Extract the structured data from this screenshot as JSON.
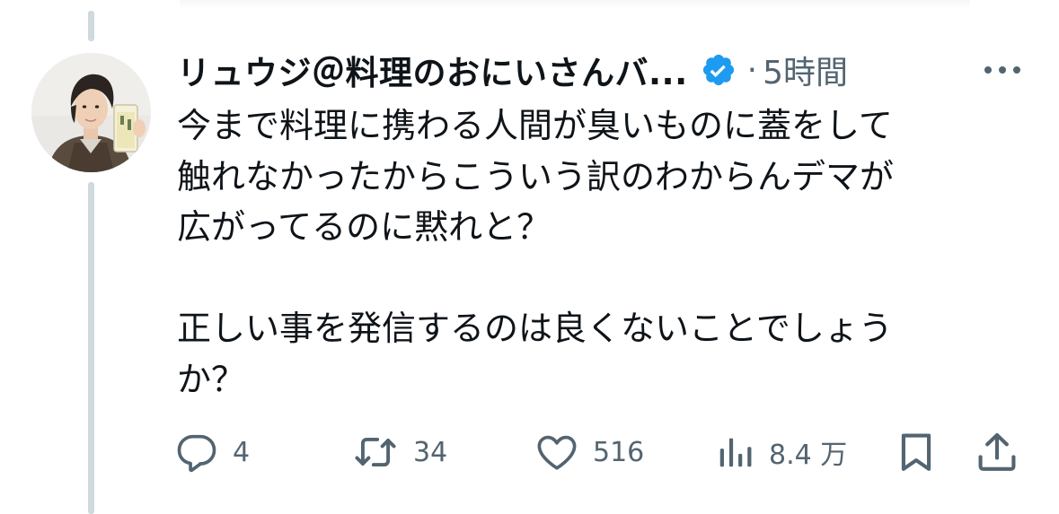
{
  "tweet": {
    "author_name": "リュウジ＠料理のおにいさんバ...",
    "separator": "·",
    "time": "5時間",
    "text_lines": [
      "今まで料理に携わる人間が臭いものに蓋をして",
      "触れなかったからこういう訳のわからんデマが",
      "広がってるのに黙れと？",
      "正しい事を発信するのは良くないことでしょう",
      "か？"
    ]
  },
  "actions": {
    "reply_count": "4",
    "retweet_count": "34",
    "like_count": "516",
    "views_count": "8.4 万"
  },
  "icons": {
    "verified": "verified-badge-icon",
    "more": "more-icon",
    "reply": "reply-icon",
    "retweet": "retweet-icon",
    "like": "heart-icon",
    "views": "views-icon",
    "bookmark": "bookmark-icon",
    "share": "share-icon"
  },
  "colors": {
    "verified_blue": "#1d9bf0",
    "muted_text": "#536471",
    "primary_text": "#0f1419",
    "thread_line": "#cfd9de"
  }
}
